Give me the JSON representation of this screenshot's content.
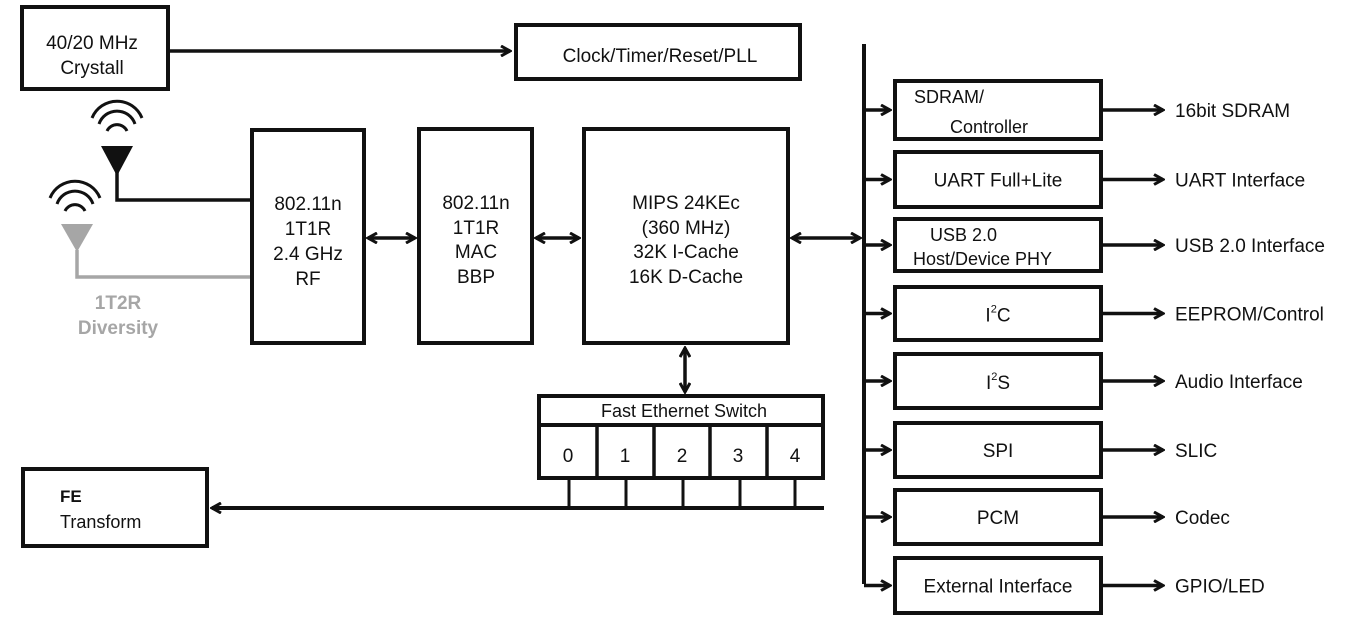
{
  "crystal": {
    "line1": "40/20 MHz",
    "line2": "Crystall"
  },
  "clock": {
    "label": "Clock/Timer/Reset/PLL"
  },
  "rf": {
    "lines": [
      "802.11n",
      "1T1R",
      "2.4 GHz",
      "RF"
    ]
  },
  "mac": {
    "lines": [
      "802.11n",
      "1T1R",
      "MAC",
      "BBP"
    ]
  },
  "cpu": {
    "lines": [
      "MIPS 24KEc",
      "(360 MHz)",
      "32K I-Cache",
      "16K D-Cache"
    ]
  },
  "diversity": {
    "line1": "1T2R",
    "line2": "Diversity",
    "color": "#a6a6a6"
  },
  "switch": {
    "title": "Fast Ethernet Switch",
    "ports": [
      "0",
      "1",
      "2",
      "3",
      "4"
    ]
  },
  "fe": {
    "line1": "FE",
    "line2": "Transform"
  },
  "peripherals": [
    {
      "block": [
        "SDRAM/",
        "Controller"
      ],
      "output": "16bit SDRAM"
    },
    {
      "block": [
        "UART Full+Lite"
      ],
      "output": "UART Interface"
    },
    {
      "block": [
        "USB 2.0",
        "Host/Device PHY"
      ],
      "output": "USB 2.0 Interface"
    },
    {
      "block": [
        "I",
        "2",
        "C"
      ],
      "output": "EEPROM/Control"
    },
    {
      "block": [
        "I",
        "2",
        "S"
      ],
      "output": "Audio Interface"
    },
    {
      "block": [
        "SPI"
      ],
      "output": "SLIC"
    },
    {
      "block": [
        "PCM"
      ],
      "output": "Codec"
    },
    {
      "block": [
        "External Interface"
      ],
      "output": "GPIO/LED"
    }
  ]
}
